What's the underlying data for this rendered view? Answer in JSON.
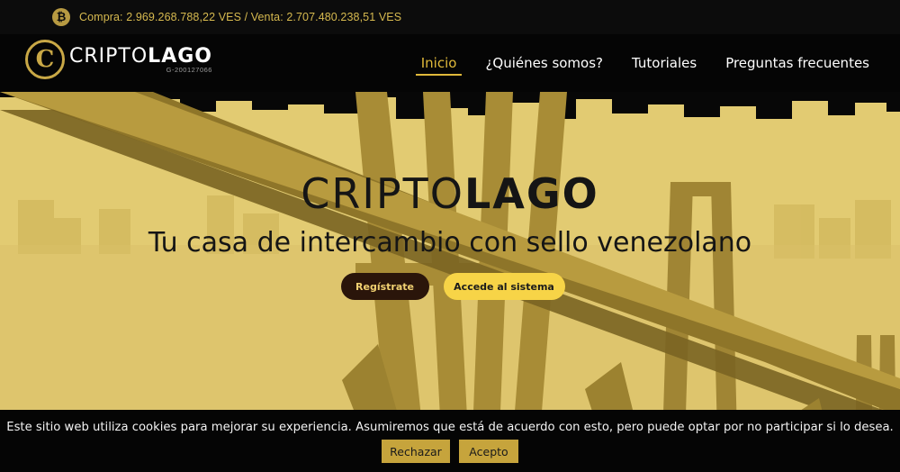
{
  "ticker": {
    "icon": "bitcoin-icon",
    "text": "Compra: 2.969.268.788,22 VES / Venta: 2.707.480.238,51 VES"
  },
  "logo": {
    "badge_letter": "C",
    "name_light": "CRIPTO",
    "name_bold": "LAGO",
    "rif": "G-200127066"
  },
  "nav": {
    "items": [
      {
        "label": "Inicio",
        "active": true
      },
      {
        "label": "¿Quiénes somos?",
        "active": false
      },
      {
        "label": "Tutoriales",
        "active": false
      },
      {
        "label": "Preguntas frecuentes",
        "active": false
      }
    ]
  },
  "hero": {
    "title_light": "CRIPTO",
    "title_bold": "LAGO",
    "subtitle": "Tu casa de intercambio con sello venezolano",
    "register_label": "Regístrate",
    "access_label": "Accede al sistema"
  },
  "cookie": {
    "text": "Este sitio web utiliza cookies para mejorar su experiencia. Asumiremos que está de acuerdo con esto, pero puede optar por no participar si lo desea.",
    "reject_label": "Rechazar",
    "accept_label": "Acepto"
  },
  "colors": {
    "accent": "#e0b93a",
    "hero_bg": "#e2cb72",
    "bridge": "#a58a35",
    "dark": "#050505"
  }
}
